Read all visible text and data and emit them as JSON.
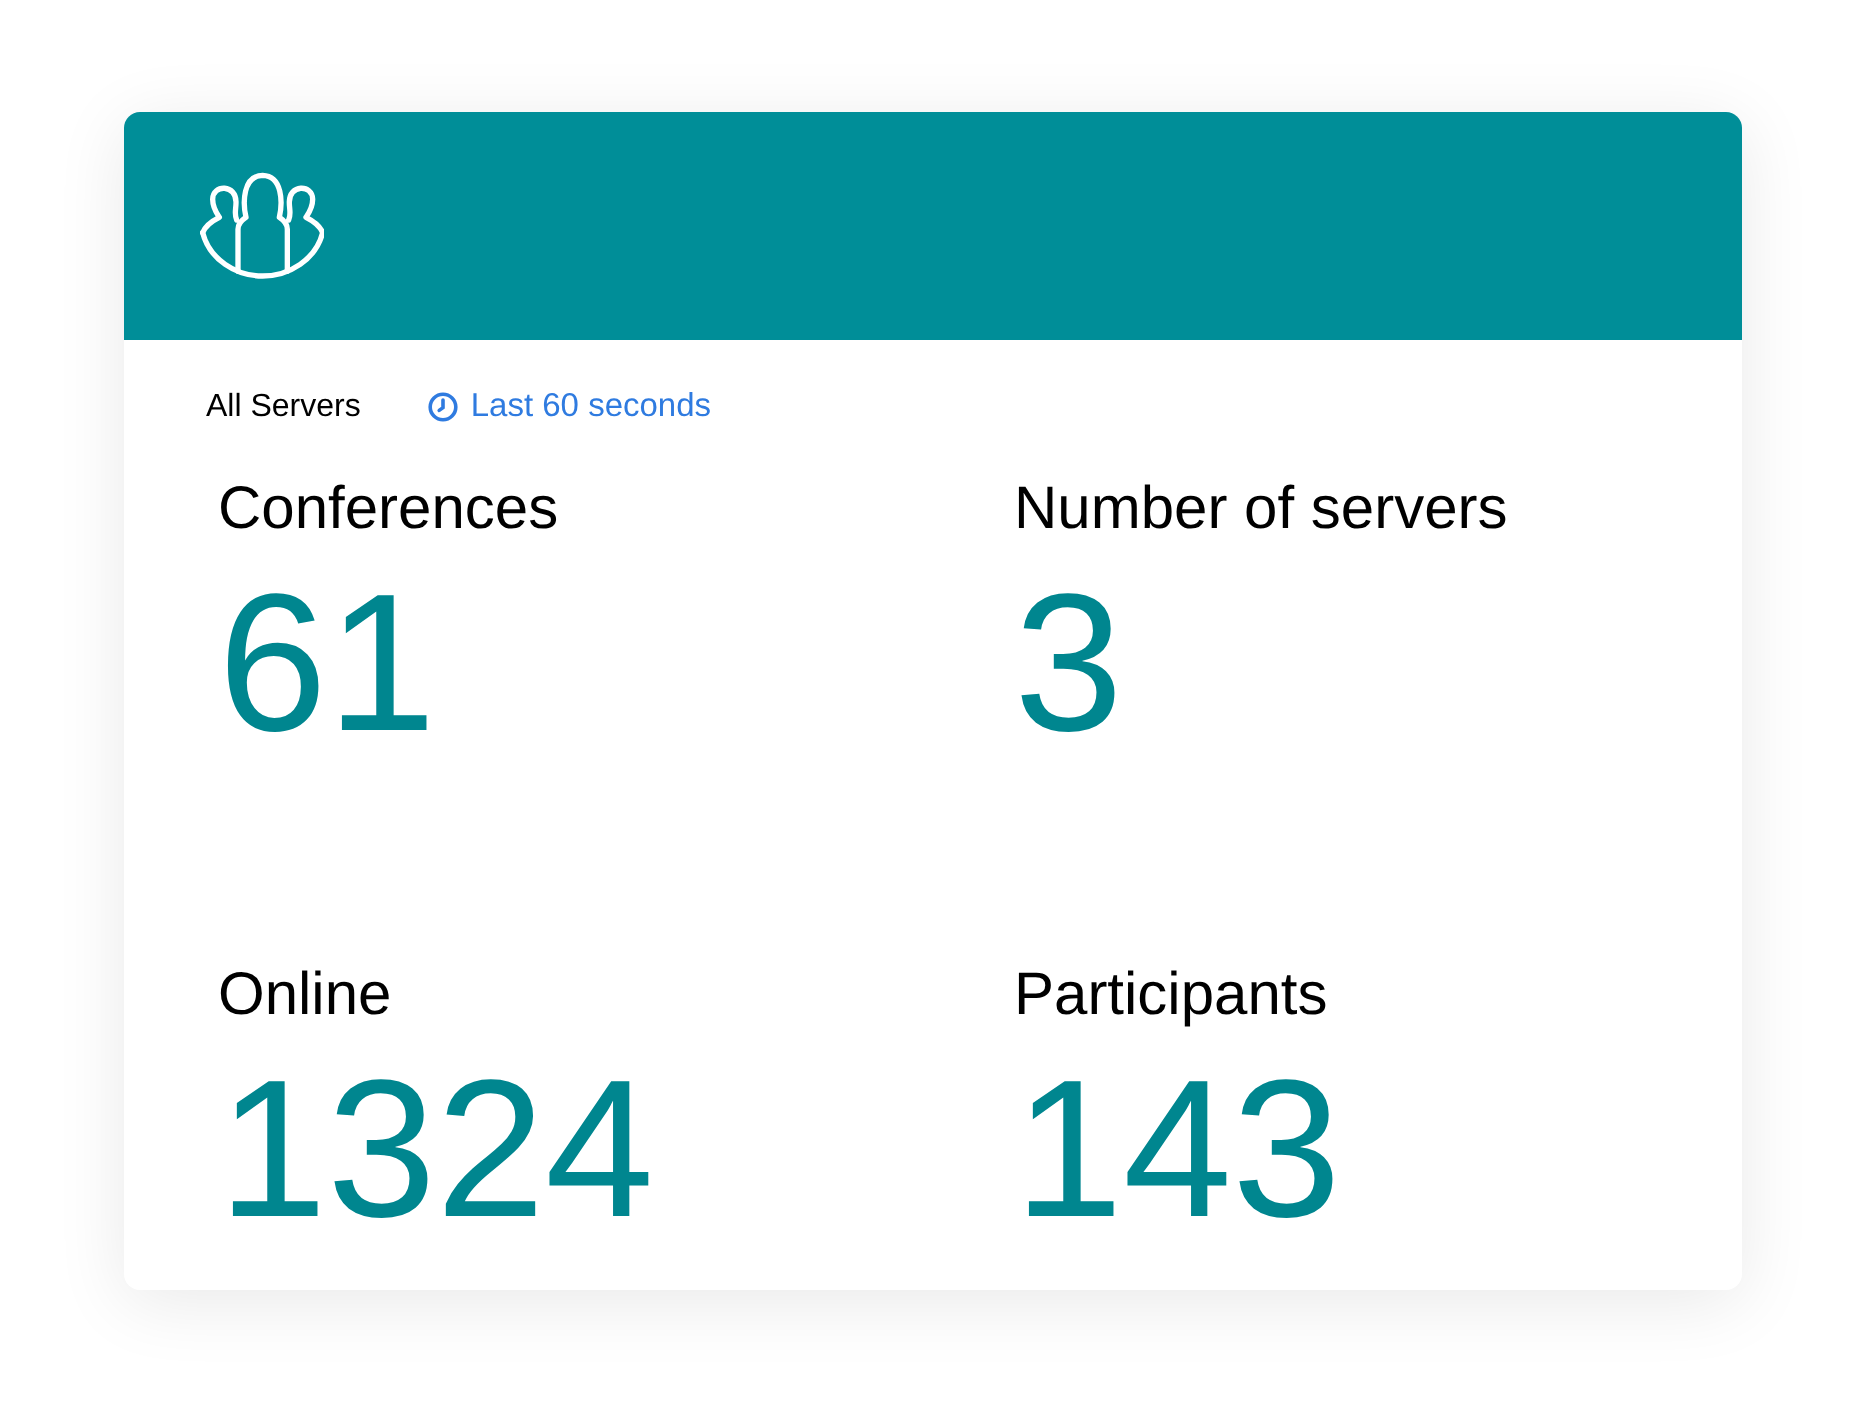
{
  "filter": {
    "scope": "All Servers",
    "time_range": "Last 60 seconds"
  },
  "stats": [
    {
      "label": "Conferences",
      "value": "61"
    },
    {
      "label": "Number of servers",
      "value": "3"
    },
    {
      "label": "Online",
      "value": "1324"
    },
    {
      "label": "Participants",
      "value": "143"
    }
  ]
}
